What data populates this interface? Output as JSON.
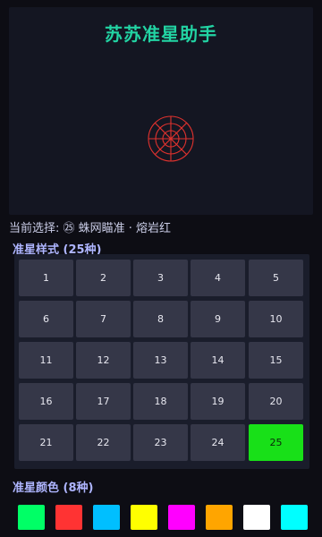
{
  "app": {
    "title": "苏苏准星助手"
  },
  "status": {
    "current_selection": "当前选择: ㉕ 蛛网瞄准 · 熔岩红"
  },
  "styles_section": {
    "title": "准星样式 (25种)",
    "items": [
      "1",
      "2",
      "3",
      "4",
      "5",
      "6",
      "7",
      "8",
      "9",
      "10",
      "11",
      "12",
      "13",
      "14",
      "15",
      "16",
      "17",
      "18",
      "19",
      "20",
      "21",
      "22",
      "23",
      "24",
      "25"
    ],
    "selected_index": 24,
    "selected_color": "#18e018"
  },
  "colors_section": {
    "title": "准星颜色 (8种)",
    "swatches": [
      "#00ff66",
      "#ff3333",
      "#00bfff",
      "#ffff00",
      "#ff00ff",
      "#ffa500",
      "#ffffff",
      "#00ffff"
    ]
  },
  "crosshair": {
    "name": "蛛网瞄准",
    "color_name": "熔岩红",
    "color": "#e0322e",
    "icon": "spiderweb-crosshair-icon"
  }
}
